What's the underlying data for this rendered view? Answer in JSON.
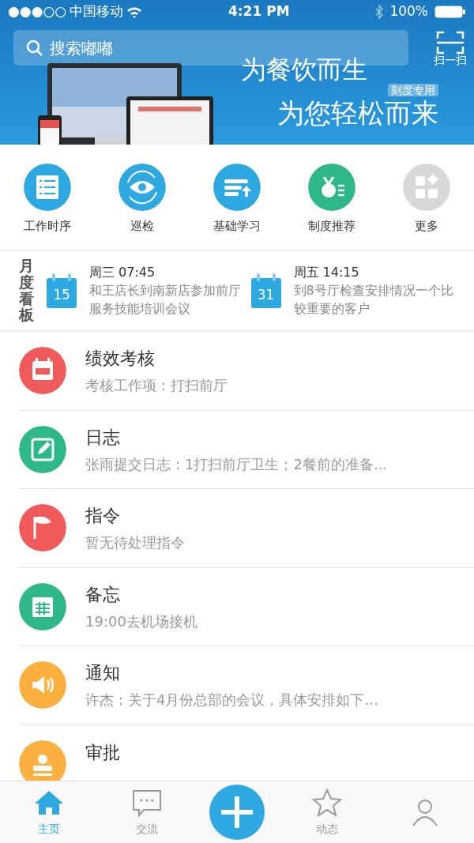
{
  "status_bar": {
    "signal_dots": "●●●○○",
    "carrier": "中国移动",
    "time": "4:21 PM",
    "battery": "100%"
  },
  "header": {
    "search": {
      "placeholder": "搜索嘟嘟"
    },
    "scan_label": "扫一扫"
  },
  "banner": {
    "headline": "为餐饮而生",
    "tag": "刻度专用",
    "subline": "为您轻松而来"
  },
  "shortcuts": [
    {
      "label": "工作时序",
      "kind": "list",
      "color": "#2ea8e0"
    },
    {
      "label": "巡检",
      "kind": "eye",
      "color": "#2ea8e0"
    },
    {
      "label": "基础学习",
      "kind": "study",
      "color": "#2ea8e0"
    },
    {
      "label": "制度推荐",
      "kind": "medal",
      "color": "#2eb888"
    },
    {
      "label": "更多",
      "kind": "more",
      "color": "#d8d8d8"
    }
  ],
  "board": {
    "title": "月度看板",
    "events": [
      {
        "day": "15",
        "when": "周三 07:45",
        "text": "和王店长到南新店参加前厅服务技能培训会议"
      },
      {
        "day": "31",
        "when": "周五 14:15",
        "text": "到8号厅检查安排情况一个比较重要的客户"
      }
    ]
  },
  "feed": [
    {
      "kind": "score",
      "color": "#f05a5a",
      "title": "绩效考核",
      "summary": "考核工作项：打扫前厅"
    },
    {
      "kind": "log",
      "color": "#2eb888",
      "title": "日志",
      "summary": "张雨提交日志：1打扫前厅卫生；2餐前的准备..."
    },
    {
      "kind": "flag",
      "color": "#f05a5a",
      "title": "指令",
      "summary": "暂无待处理指令"
    },
    {
      "kind": "calendar",
      "color": "#2eb888",
      "title": "备忘",
      "summary": "19:00去机场接机"
    },
    {
      "kind": "speaker",
      "color": "#fbb040",
      "title": "通知",
      "summary": "许杰：关于4月份总部的会议，具体安排如下..."
    },
    {
      "kind": "stamp",
      "color": "#fbb040",
      "title": "审批"
    }
  ],
  "tabs": [
    {
      "label": "主页",
      "kind": "home",
      "selected": true
    },
    {
      "label": "交流",
      "kind": "chat",
      "selected": false
    },
    {
      "kind": "add"
    },
    {
      "label": "动态",
      "kind": "star",
      "selected": false
    },
    {
      "kind": "person",
      "selected": false
    }
  ]
}
